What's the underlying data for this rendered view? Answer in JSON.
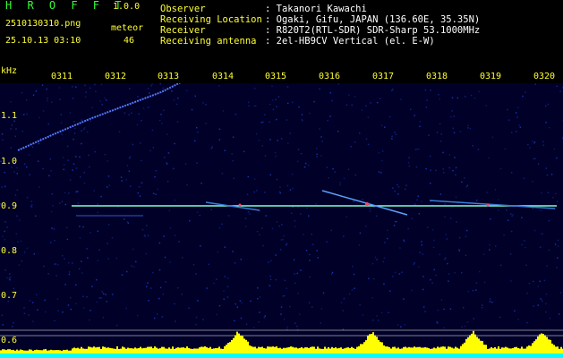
{
  "header": {
    "app_title": "H R O F F T",
    "app_version": "1.0.0",
    "file_name": "2510130310.png",
    "meteor_label": "meteor",
    "date_time": "25.10.13 03:10",
    "meteor_count": "46"
  },
  "station_info": [
    {
      "key": "Observer",
      "value": ": Takanori Kawachi"
    },
    {
      "key": "Receiving Location",
      "value": ": Ogaki, Gifu, JAPAN (136.60E, 35.35N)"
    },
    {
      "key": "Receiver",
      "value": ": R820T2(RTL-SDR) SDR-Sharp 53.1000MHz"
    },
    {
      "key": "Receiving antenna",
      "value": ": 2el-HB9CV Vertical (el. E-W)"
    }
  ],
  "chart_data": {
    "type": "heatmap",
    "ylabel": "kHz",
    "yticks": [
      "1.1",
      "1.0",
      "0.9",
      "0.8",
      "0.7",
      "0.6"
    ],
    "xticks": [
      "0311",
      "0312",
      "0313",
      "0314",
      "0315",
      "0316",
      "0317",
      "0318",
      "0319",
      "0320"
    ],
    "colors": {
      "background": "#000033",
      "signal_line": "#7fffd4",
      "noise_lower": "#00ffff",
      "noise_upper": "#ffff00",
      "axis_text": "#ffff33"
    }
  }
}
